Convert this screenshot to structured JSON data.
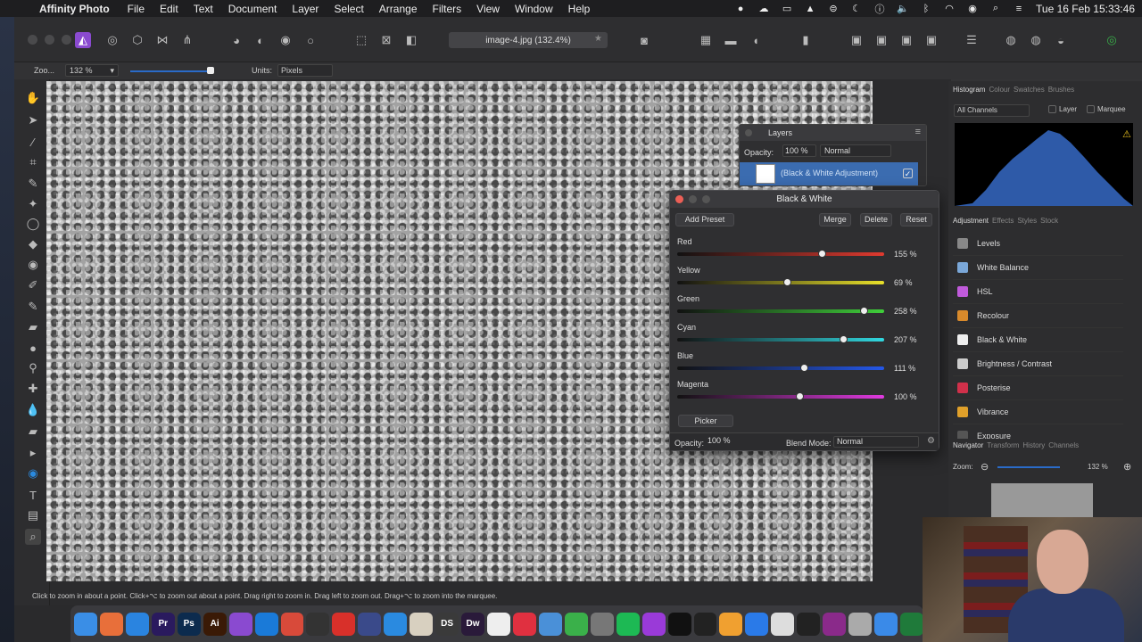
{
  "menubar": {
    "app": "Affinity Photo",
    "items": [
      "File",
      "Edit",
      "Text",
      "Document",
      "Layer",
      "Select",
      "Arrange",
      "Filters",
      "View",
      "Window",
      "Help"
    ],
    "datetime": "Tue 16 Feb  15:33:46"
  },
  "toolbar": {
    "document_tab": "image-4.jpg (132.4%)"
  },
  "context": {
    "zoom_label": "Zoo...",
    "zoom_value": "132 %",
    "units_label": "Units:",
    "units_value": "Pixels"
  },
  "layers": {
    "title": "Layers",
    "opacity_label": "Opacity:",
    "opacity_value": "100 %",
    "blend": "Normal",
    "layer_name": "(Black & White Adjustment)"
  },
  "bw_dialog": {
    "title": "Black & White",
    "add_preset": "Add Preset",
    "merge": "Merge",
    "delete": "Delete",
    "reset": "Reset",
    "sliders": [
      {
        "label": "Red",
        "value": "155 %",
        "fraction": 0.7,
        "color": "#e03a2f"
      },
      {
        "label": "Yellow",
        "value": "69 %",
        "fraction": 0.53,
        "color": "#e8e02a"
      },
      {
        "label": "Green",
        "value": "258 %",
        "fraction": 0.9,
        "color": "#3fcf3a"
      },
      {
        "label": "Cyan",
        "value": "207 %",
        "fraction": 0.8,
        "color": "#31d8e0"
      },
      {
        "label": "Blue",
        "value": "111 %",
        "fraction": 0.61,
        "color": "#2457e8"
      },
      {
        "label": "Magenta",
        "value": "100 %",
        "fraction": 0.59,
        "color": "#e03ae0"
      }
    ],
    "picker": "Picker",
    "opacity_label": "Opacity:",
    "opacity_value": "100 %",
    "blend_label": "Blend Mode:",
    "blend_value": "Normal"
  },
  "histogram": {
    "tabs": [
      "Histogram",
      "Colour",
      "Swatches",
      "Brushes"
    ],
    "channels": "All Channels",
    "layer_opt": "Layer",
    "marquee_opt": "Marquee"
  },
  "adjustments": {
    "tabs": [
      "Adjustment",
      "Effects",
      "Styles",
      "Stock"
    ],
    "items": [
      {
        "label": "Levels",
        "color": "#888"
      },
      {
        "label": "White Balance",
        "color": "#7aa7d8"
      },
      {
        "label": "HSL",
        "color": "#c05adb"
      },
      {
        "label": "Recolour",
        "color": "#d98a2b"
      },
      {
        "label": "Black & White",
        "color": "#eee"
      },
      {
        "label": "Brightness / Contrast",
        "color": "#ccc"
      },
      {
        "label": "Posterise",
        "color": "#d0304a"
      },
      {
        "label": "Vibrance",
        "color": "#e0a02a"
      },
      {
        "label": "Exposure",
        "color": "#555"
      }
    ]
  },
  "navigator": {
    "tabs": [
      "Navigator",
      "Transform",
      "History",
      "Channels"
    ],
    "zoom_label": "Zoom:",
    "zoom_value": "132 %"
  },
  "status": {
    "hint": "Click to zoom in about a point. Click+⌥ to zoom out about a point. Drag right to zoom in. Drag left to zoom out. Drag+⌥ to zoom into the marquee."
  },
  "dock": {
    "apps": [
      {
        "name": "finder",
        "color": "#3a8ee6",
        "glyph": ""
      },
      {
        "name": "launchpad",
        "color": "#e86f3a",
        "glyph": ""
      },
      {
        "name": "safari",
        "color": "#2a84e0",
        "glyph": ""
      },
      {
        "name": "premiere",
        "color": "#2a1a5e",
        "glyph": "Pr"
      },
      {
        "name": "photoshop",
        "color": "#0c2b4e",
        "glyph": "Ps"
      },
      {
        "name": "illustrator",
        "color": "#3a1a06",
        "glyph": "Ai"
      },
      {
        "name": "affinity-photo",
        "color": "#8a4ad0",
        "glyph": ""
      },
      {
        "name": "affinity-designer",
        "color": "#1a7ad8",
        "glyph": ""
      },
      {
        "name": "affinity-publisher",
        "color": "#d84a3a",
        "glyph": ""
      },
      {
        "name": "lasso",
        "color": "#333",
        "glyph": ""
      },
      {
        "name": "s-app",
        "color": "#d8302a",
        "glyph": ""
      },
      {
        "name": "globe",
        "color": "#3a4a8a",
        "glyph": ""
      },
      {
        "name": "compass",
        "color": "#2a8ae0",
        "glyph": ""
      },
      {
        "name": "anatomy",
        "color": "#d8d0c0",
        "glyph": ""
      },
      {
        "name": "ds",
        "color": "#3a3a3a",
        "glyph": "DS"
      },
      {
        "name": "dreamweaver",
        "color": "#2a1a3a",
        "glyph": "Dw"
      },
      {
        "name": "calendar",
        "color": "#eee",
        "glyph": ""
      },
      {
        "name": "news",
        "color": "#e03040",
        "glyph": ""
      },
      {
        "name": "files",
        "color": "#4a90d8",
        "glyph": ""
      },
      {
        "name": "chart-app",
        "color": "#3ab04a",
        "glyph": ""
      },
      {
        "name": "settings",
        "color": "#777",
        "glyph": ""
      },
      {
        "name": "spotify",
        "color": "#1db954",
        "glyph": ""
      },
      {
        "name": "podcasts",
        "color": "#9a3ad8",
        "glyph": ""
      },
      {
        "name": "terminal",
        "color": "#111",
        "glyph": ""
      },
      {
        "name": "analog",
        "color": "#222",
        "glyph": ""
      },
      {
        "name": "live",
        "color": "#f0a030",
        "glyph": ""
      },
      {
        "name": "zoom",
        "color": "#2a7ae8",
        "glyph": ""
      },
      {
        "name": "chrome",
        "color": "#ddd",
        "glyph": ""
      },
      {
        "name": "obs",
        "color": "#222",
        "glyph": ""
      },
      {
        "name": "p-app",
        "color": "#8a2a8a",
        "glyph": ""
      },
      {
        "name": "script",
        "color": "#aaa",
        "glyph": ""
      },
      {
        "name": "app-x",
        "color": "#3a8ae8",
        "glyph": ""
      },
      {
        "name": "excel",
        "color": "#1f7a3a",
        "glyph": ""
      }
    ]
  }
}
